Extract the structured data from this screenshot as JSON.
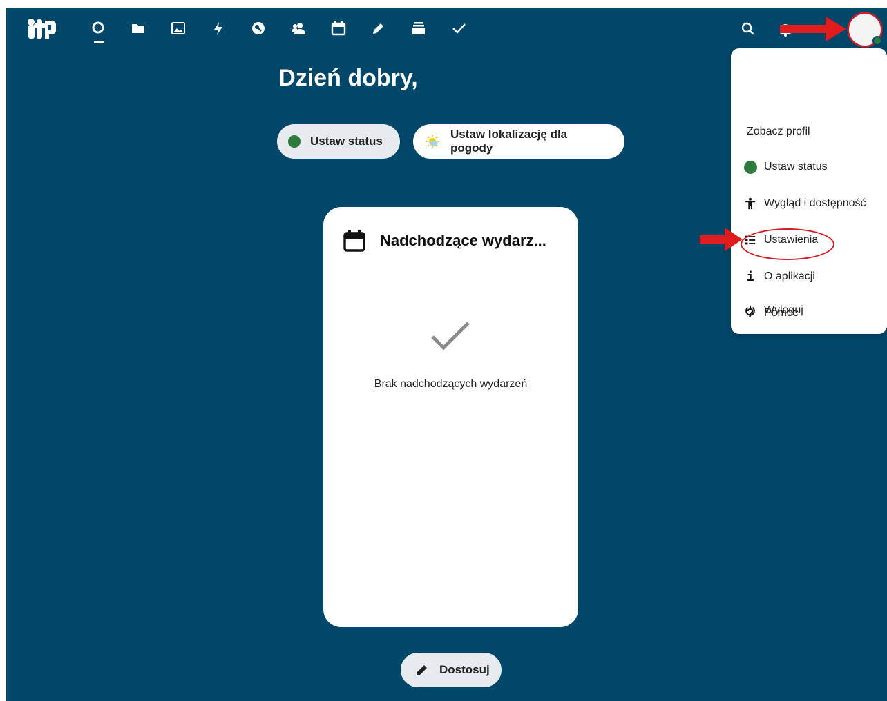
{
  "header": {
    "apps": [
      {
        "icon": "dashboard-icon",
        "label": ""
      },
      {
        "icon": "files-icon",
        "label": ""
      },
      {
        "icon": "photos-icon",
        "label": ""
      },
      {
        "icon": "activity-icon",
        "label": ""
      },
      {
        "icon": "passwords-icon",
        "label": ""
      },
      {
        "icon": "contacts-icon",
        "label": ""
      },
      {
        "icon": "calendar-icon",
        "label": ""
      },
      {
        "icon": "notes-icon",
        "label": ""
      },
      {
        "icon": "deck-icon",
        "label": ""
      },
      {
        "icon": "tasks-icon",
        "label": ""
      }
    ],
    "right_icons": [
      "search-icon",
      "notifications-icon"
    ]
  },
  "main": {
    "greeting": "Dzień dobry,",
    "status_button": "Ustaw status",
    "weather_button": "Ustaw lokalizację dla pogody",
    "customize_button": "Dostosuj"
  },
  "widget": {
    "title": "Nadchodzące wydarz...",
    "empty_text": "Brak nadchodzących wydarzeń"
  },
  "user_menu": {
    "profile": "Zobacz profil",
    "items": [
      {
        "icon": "status-dot-icon",
        "label": "Ustaw status"
      },
      {
        "icon": "accessibility-icon",
        "label": "Wygląd i dostępność"
      },
      {
        "icon": "settings-list-icon",
        "label": "Ustawienia"
      },
      {
        "icon": "info-icon",
        "label": "O aplikacji"
      },
      {
        "icon": "help-icon",
        "label": "Pomoc"
      },
      {
        "icon": "power-icon",
        "label": "Wyloguj"
      }
    ]
  },
  "colors": {
    "background": "#00476a",
    "status_green": "#2d7b3a",
    "annotation_red": "#d51c24"
  }
}
